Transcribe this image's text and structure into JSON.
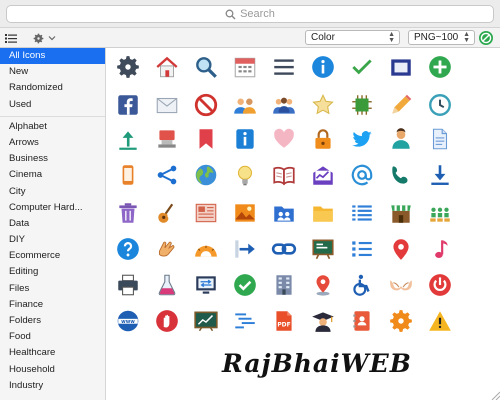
{
  "search": {
    "placeholder": "Search"
  },
  "toolbar": {
    "color_select": "Color",
    "format_select": "PNG~100",
    "list_icon": "list-icon",
    "gear_icon": "gear-icon"
  },
  "sidebar": {
    "groups": [
      {
        "items": [
          "All Icons",
          "New",
          "Randomized",
          "Used"
        ],
        "selected": "All Icons"
      },
      {
        "items": [
          "Alphabet",
          "Arrows",
          "Business",
          "Cinema",
          "City",
          "Computer Hard...",
          "Data",
          "DIY",
          "Ecommerce",
          "Editing",
          "Files",
          "Finance",
          "Folders",
          "Food",
          "Healthcare",
          "Household",
          "Industry"
        ]
      }
    ]
  },
  "icons": [
    [
      "gear-icon",
      "home-icon",
      "search-icon",
      "calendar-icon",
      "menu-icon",
      "info-icon",
      "checkmark-icon",
      "picture-frame-icon",
      "plus-icon"
    ],
    [
      "facebook-icon",
      "envelope-icon",
      "no-entry-icon",
      "team-icon",
      "group-icon",
      "star-icon",
      "chip-icon",
      "pencil-icon",
      "clock-icon"
    ],
    [
      "upload-icon",
      "stamp-icon",
      "bookmark-icon",
      "info-card-icon",
      "heart-icon",
      "lock-icon",
      "twitter-icon",
      "person-icon",
      "document-icon"
    ],
    [
      "smartphone-icon",
      "share-icon",
      "globe-icon",
      "light-bulb-icon",
      "open-book-icon",
      "inbox-chart-icon",
      "at-sign-icon",
      "phone-handset-icon",
      "download-icon"
    ],
    [
      "trash-icon",
      "guitar-icon",
      "newspaper-icon",
      "landscape-image-icon",
      "people-folder-icon",
      "folder-icon",
      "list-lines-icon",
      "storefront-icon",
      "audience-icon"
    ],
    [
      "help-icon",
      "clapping-hands-icon",
      "protractor-icon",
      "arrow-right-box-icon",
      "chain-link-icon",
      "blackboard-icon",
      "checklist-icon",
      "map-pin-icon",
      "music-note-icon"
    ],
    [
      "printer-icon",
      "flask-icon",
      "transfer-monitor-icon",
      "check-circle-icon",
      "office-building-icon",
      "location-pin-icon",
      "wheelchair-icon",
      "bra-icon",
      "power-icon"
    ],
    [
      "www-icon",
      "stop-hand-icon",
      "chart-board-icon",
      "text-align-icon",
      "pdf-icon",
      "graduate-icon",
      "contacts-book-icon",
      "cog-orange-icon",
      "warning-icon"
    ]
  ],
  "watermark": "RajBhaiWEB"
}
